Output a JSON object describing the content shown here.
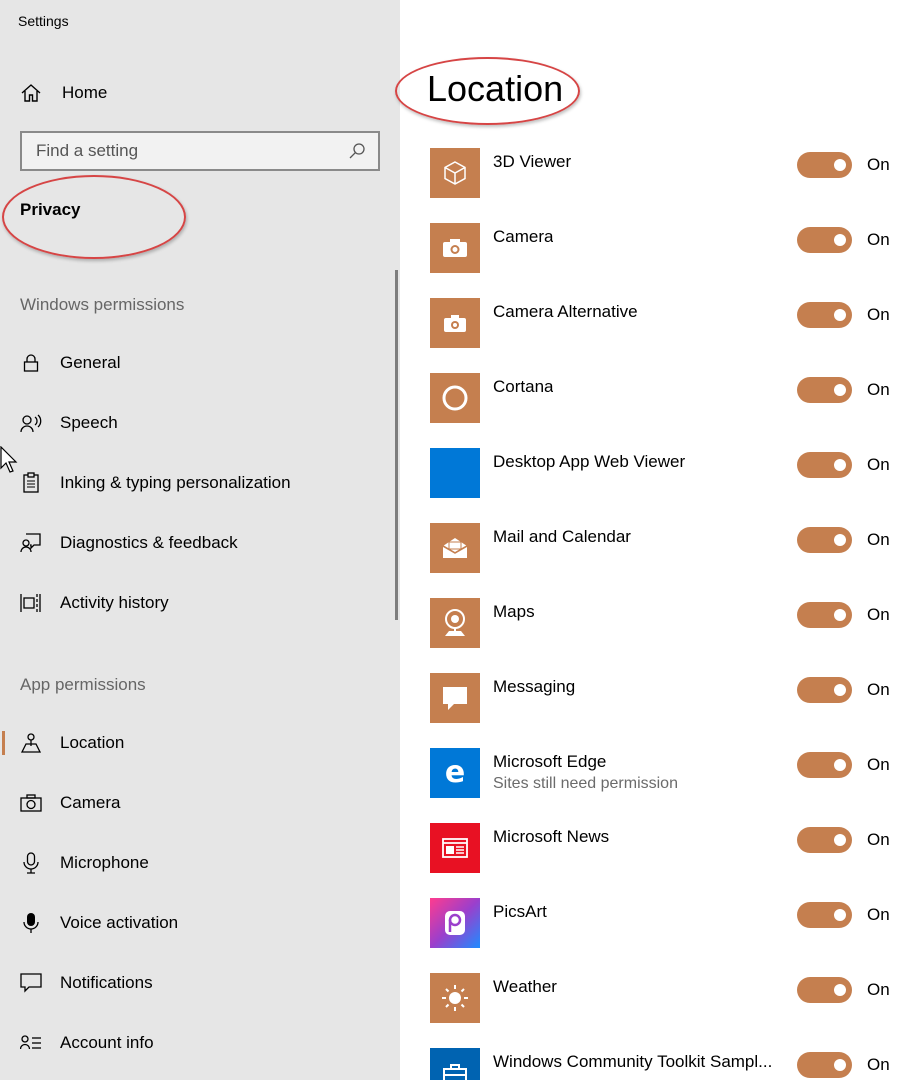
{
  "window": {
    "title": "Settings"
  },
  "sidebar": {
    "home_label": "Home",
    "search_placeholder": "Find a setting",
    "section_title": "Privacy",
    "windows_permissions_header": "Windows permissions",
    "windows_permissions": [
      {
        "label": "General",
        "icon": "lock-icon"
      },
      {
        "label": "Speech",
        "icon": "speech-icon"
      },
      {
        "label": "Inking & typing personalization",
        "icon": "clipboard-icon"
      },
      {
        "label": "Diagnostics & feedback",
        "icon": "feedback-icon"
      },
      {
        "label": "Activity history",
        "icon": "activity-icon"
      }
    ],
    "app_permissions_header": "App permissions",
    "app_permissions": [
      {
        "label": "Location",
        "icon": "location-icon",
        "active": true
      },
      {
        "label": "Camera",
        "icon": "camera-icon"
      },
      {
        "label": "Microphone",
        "icon": "microphone-icon"
      },
      {
        "label": "Voice activation",
        "icon": "voice-activation-icon"
      },
      {
        "label": "Notifications",
        "icon": "notifications-icon"
      },
      {
        "label": "Account info",
        "icon": "account-info-icon"
      }
    ]
  },
  "main": {
    "title": "Location",
    "toggle_on_label": "On",
    "apps": [
      {
        "name": "3D Viewer",
        "icon": "3d-viewer-icon",
        "icon_bg": "#c57f4f",
        "state": "On"
      },
      {
        "name": "Camera",
        "icon": "camera-icon",
        "icon_bg": "#c57f4f",
        "state": "On"
      },
      {
        "name": "Camera Alternative",
        "icon": "camera-icon",
        "icon_bg": "#c57f4f",
        "state": "On"
      },
      {
        "name": "Cortana",
        "icon": "cortana-icon",
        "icon_bg": "#c57f4f",
        "state": "On"
      },
      {
        "name": "Desktop App Web Viewer",
        "icon": "blank-app-icon",
        "icon_bg": "#0078d7",
        "state": "On"
      },
      {
        "name": "Mail and Calendar",
        "icon": "mail-icon",
        "icon_bg": "#c57f4f",
        "state": "On"
      },
      {
        "name": "Maps",
        "icon": "maps-icon",
        "icon_bg": "#c57f4f",
        "state": "On"
      },
      {
        "name": "Messaging",
        "icon": "messaging-icon",
        "icon_bg": "#c57f4f",
        "state": "On"
      },
      {
        "name": "Microsoft Edge",
        "subtitle": "Sites still need permission",
        "icon": "edge-icon",
        "icon_bg": "#0078d7",
        "state": "On"
      },
      {
        "name": "Microsoft News",
        "icon": "news-icon",
        "icon_bg": "#e81123",
        "state": "On"
      },
      {
        "name": "PicsArt",
        "icon": "picsart-icon",
        "icon_bg": "#9b3fcc",
        "state": "On"
      },
      {
        "name": "Weather",
        "icon": "weather-icon",
        "icon_bg": "#c57f4f",
        "state": "On"
      },
      {
        "name": "Windows Community Toolkit Sampl...",
        "icon": "toolkit-icon",
        "icon_bg": "#0063b1",
        "state": "On"
      }
    ]
  },
  "colors": {
    "accent": "#c57f4f",
    "sidebar_bg": "#e6e6e6",
    "annotation_red": "#d64545"
  }
}
